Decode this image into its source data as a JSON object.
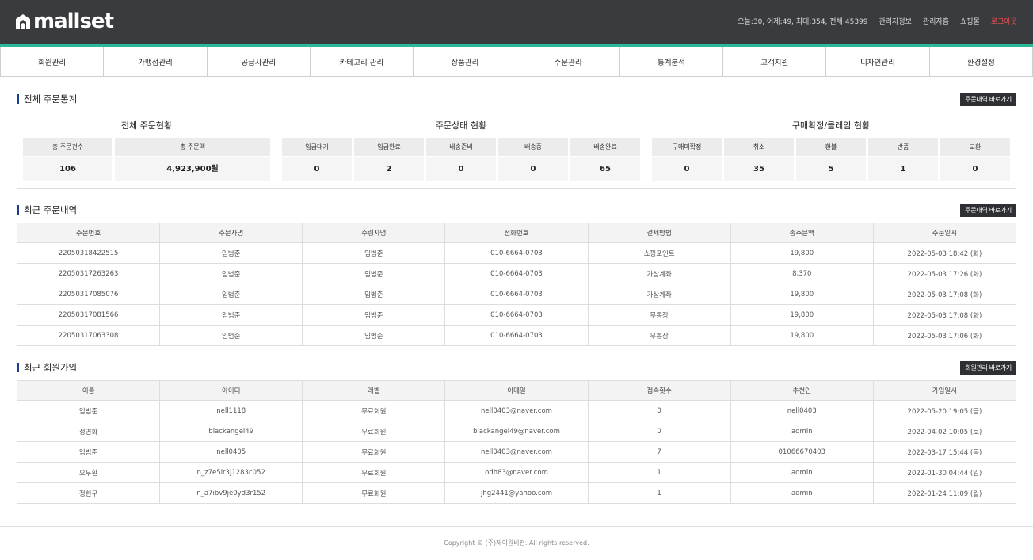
{
  "brand": {
    "logo_text": "mallset"
  },
  "top_links": {
    "stats": "오늘:30, 어제:49, 최대:354, 전체:45399",
    "admin_info": "관리자정보",
    "admin_home": "관리자홈",
    "shop": "쇼핑몰",
    "logout": "로그아웃"
  },
  "nav": [
    "회원관리",
    "가맹점관리",
    "공급사관리",
    "카테고리 관리",
    "상품관리",
    "주문관리",
    "통계분석",
    "고객지원",
    "디자인관리",
    "환경설정"
  ],
  "order_stats": {
    "title": "전체 주문통계",
    "button": "주문내역 바로가기",
    "groups": [
      {
        "title": "전체 주문현황",
        "cells": [
          {
            "label": "총 주문건수",
            "value": "106"
          },
          {
            "label": "총 주문액",
            "value": "4,923,900원"
          }
        ]
      },
      {
        "title": "주문상태 현황",
        "cells": [
          {
            "label": "입금대기",
            "value": "0"
          },
          {
            "label": "입금완료",
            "value": "2"
          },
          {
            "label": "배송준비",
            "value": "0"
          },
          {
            "label": "배송중",
            "value": "0"
          },
          {
            "label": "배송완료",
            "value": "65"
          }
        ]
      },
      {
        "title": "구매확정/클레임 현황",
        "cells": [
          {
            "label": "구매미확정",
            "value": "0"
          },
          {
            "label": "취소",
            "value": "35"
          },
          {
            "label": "환불",
            "value": "5"
          },
          {
            "label": "반품",
            "value": "1"
          },
          {
            "label": "교환",
            "value": "0"
          }
        ]
      }
    ]
  },
  "recent_orders": {
    "title": "최근 주문내역",
    "button": "주문내역 바로가기",
    "columns": [
      "주문번호",
      "주문자명",
      "수령자명",
      "전화번호",
      "결제방법",
      "총주문액",
      "주문일시"
    ],
    "rows": [
      [
        "22050318422515",
        "임범준",
        "임범준",
        "010-6664-0703",
        "쇼핑포인트",
        "19,800",
        "2022-05-03 18:42 (화)"
      ],
      [
        "22050317263263",
        "임범준",
        "임범준",
        "010-6664-0703",
        "가상계좌",
        "8,370",
        "2022-05-03 17:26 (화)"
      ],
      [
        "22050317085076",
        "임범준",
        "임범준",
        "010-6664-0703",
        "가상계좌",
        "19,800",
        "2022-05-03 17:08 (화)"
      ],
      [
        "22050317081566",
        "임범준",
        "임범준",
        "010-6664-0703",
        "무통장",
        "19,800",
        "2022-05-03 17:08 (화)"
      ],
      [
        "22050317063308",
        "임범준",
        "임범준",
        "010-6664-0703",
        "무통장",
        "19,800",
        "2022-05-03 17:06 (화)"
      ]
    ]
  },
  "recent_members": {
    "title": "최근 회원가입",
    "button": "회원관리 바로가기",
    "columns": [
      "이름",
      "아이디",
      "레벨",
      "이메일",
      "접속횟수",
      "추천인",
      "가입일시"
    ],
    "rows": [
      [
        "임범준",
        "nell1118",
        "무료회원",
        "nell0403@naver.com",
        "0",
        "nell0403",
        "2022-05-20 19:05 (금)"
      ],
      [
        "정연화",
        "blackangel49",
        "무료회원",
        "blackangel49@naver.com",
        "0",
        "admin",
        "2022-04-02 10:05 (토)"
      ],
      [
        "임범준",
        "nell0405",
        "무료회원",
        "nell0403@naver.com",
        "7",
        "01066670403",
        "2022-03-17 15:44 (목)"
      ],
      [
        "오두환",
        "n_z7e5ir3j1283c052",
        "무료회원",
        "odh83@naver.com",
        "1",
        "admin",
        "2022-01-30 04:44 (일)"
      ],
      [
        "정현구",
        "n_a7ibv9je0yd3r152",
        "무료회원",
        "jhg2441@yahoo.com",
        "1",
        "admin",
        "2022-01-24 11:09 (월)"
      ]
    ]
  },
  "footer": {
    "copyright": "Copyright © (주)제이원비젼. All rights reserved."
  },
  "colors": {
    "header_bg": "#3a3b3e",
    "accent": "#2db89a",
    "logout": "#f04e4e",
    "title_bar": "#1a3d8f"
  }
}
